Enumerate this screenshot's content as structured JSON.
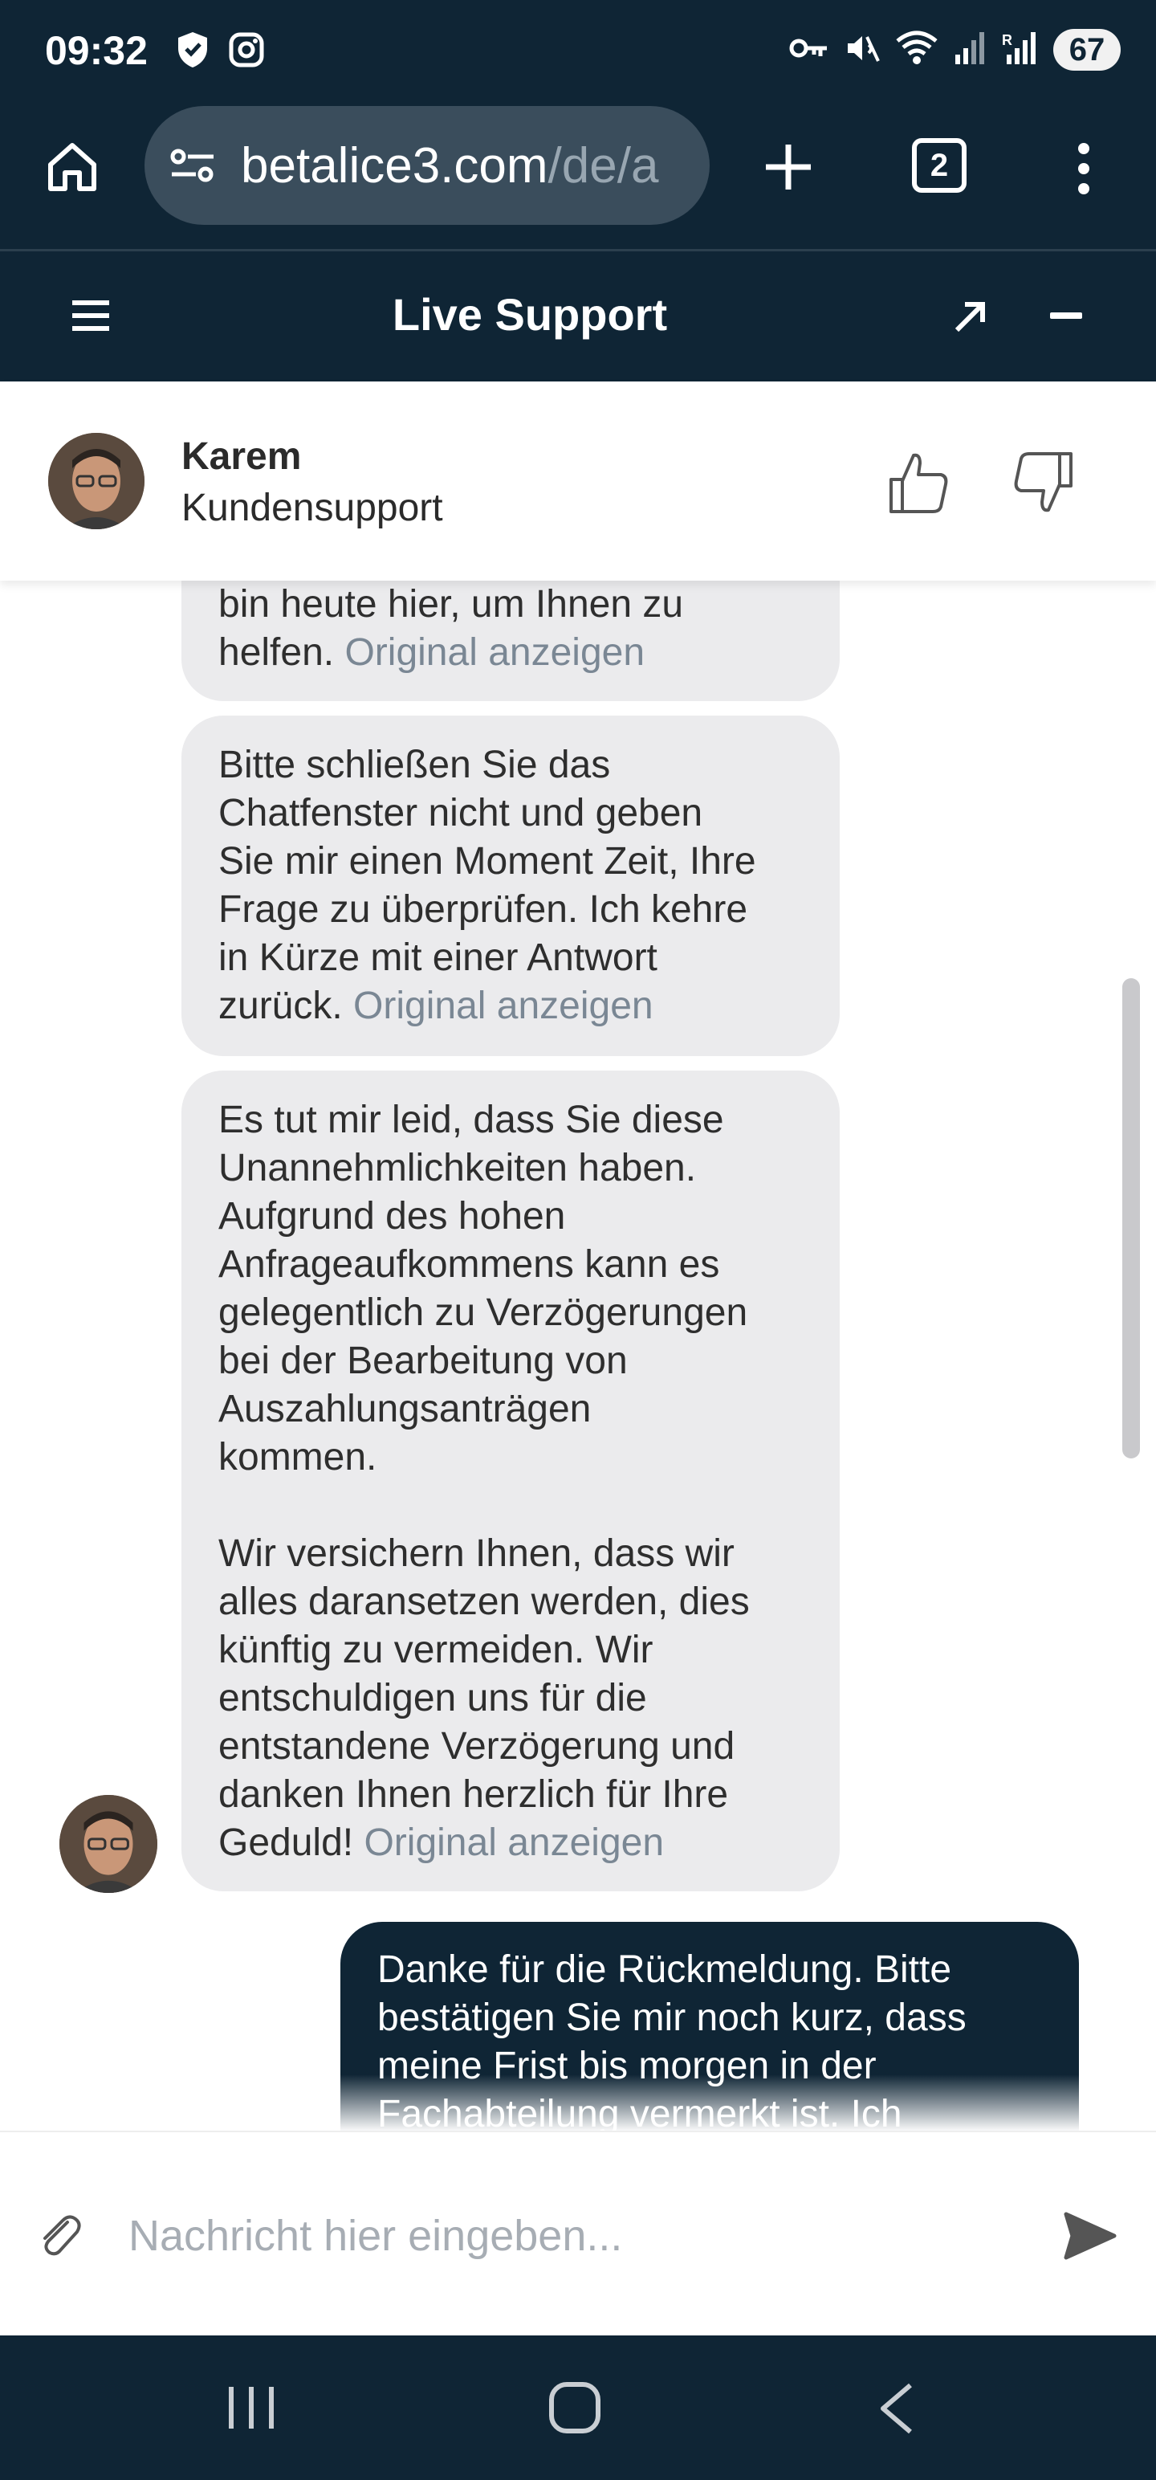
{
  "status_bar": {
    "time": "09:32",
    "battery": "67",
    "left_icons": [
      "shield-icon",
      "instagram-icon"
    ],
    "right_icons": [
      "key-icon",
      "mute-icon",
      "wifi-icon",
      "signal-icon",
      "roaming-signal-icon"
    ]
  },
  "browser": {
    "url_domain": "betalice3.com",
    "url_path": "/de/a",
    "tab_count": "2"
  },
  "chat_header": {
    "title": "Live Support"
  },
  "agent": {
    "name": "Karem",
    "role": "Kundensupport"
  },
  "messages": [
    {
      "sender": "agent",
      "text": "bin heute hier, um Ihnen zu\nhelfen. ",
      "link": "Original anzeigen"
    },
    {
      "sender": "agent",
      "text": "Bitte schließen Sie das\nChatfenster nicht und geben\nSie mir einen Moment Zeit, Ihre\nFrage zu überprüfen. Ich kehre\nin Kürze mit einer Antwort\nzurück. ",
      "link": "Original anzeigen"
    },
    {
      "sender": "agent",
      "text": "Es tut mir leid, dass Sie diese\nUnannehmlichkeiten haben.\nAufgrund des hohen\nAnfrageaufkommens kann es\ngelegentlich zu Verzögerungen\nbei der Bearbeitung von\nAuszahlungsanträgen\nkommen.\n\n Wir versichern Ihnen, dass wir\nalles daransetzen werden, dies\nkünftig zu vermeiden. Wir\nentschuldigen uns für die\nentstandene Verzögerung und\ndanken Ihnen herzlich für Ihre\nGeduld! ",
      "link": "Original anzeigen"
    },
    {
      "sender": "user",
      "text": "Danke für die Rückmeldung. Bitte bestätigen Sie mir noch kurz, dass meine Frist bis morgen in der Fachabteilung vermerkt ist. Ich"
    }
  ],
  "input": {
    "placeholder": "Nachricht hier eingeben..."
  },
  "colors": {
    "header_bg": "#0f2535",
    "agent_bubble": "#ebebed",
    "user_bubble": "#0f2535",
    "link_gray": "#7a8794"
  }
}
